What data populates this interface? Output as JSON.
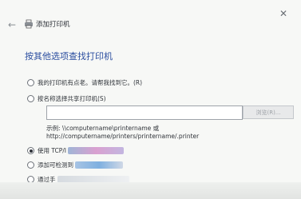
{
  "window": {
    "title": "添加打印机",
    "close_glyph": "✕",
    "back_glyph": "←"
  },
  "heading": "按其他选项查找打印机",
  "options": [
    {
      "label": "我的打印机有点老。请帮我找到它。(R)",
      "checked": false
    },
    {
      "label": "按名称选择共享打印机(S)",
      "checked": false
    },
    {
      "label": "使用 TCP/I",
      "checked": true
    },
    {
      "label": "添加可检测到",
      "checked": false
    },
    {
      "label": "通过手",
      "checked": false
    }
  ],
  "share_input": {
    "value": ""
  },
  "browse_button": {
    "label": "浏览(R)..."
  },
  "example": {
    "line1": "示例: \\\\computername\\printername 或",
    "line2": "http://computername/printers/printername/.printer"
  },
  "colors": {
    "accent": "#2a4d9f",
    "text": "#2f3339",
    "background": "#f7f8f6"
  }
}
